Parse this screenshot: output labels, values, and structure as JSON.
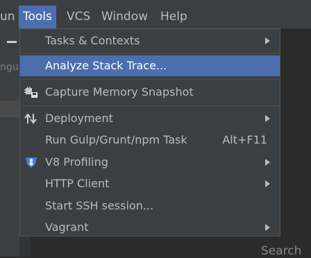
{
  "menubar": {
    "items": [
      {
        "label": "un"
      },
      {
        "label": "Tools"
      },
      {
        "label": "VCS"
      },
      {
        "label": "Window"
      },
      {
        "label": "Help"
      }
    ]
  },
  "background": {
    "left_fragment": "ngul",
    "bottom_fragment": "Search"
  },
  "colors": {
    "menu_bg": "#3c3f41",
    "highlight": "#4b6eaf",
    "text": "#bbbbbb",
    "editor_bg": "#2b2b2b"
  },
  "tools_menu": {
    "items": [
      {
        "label": "Tasks & Contexts",
        "submenu": true,
        "icon": null
      },
      {
        "label": "Analyze Stack Trace...",
        "submenu": false,
        "highlighted": true,
        "icon": null
      },
      {
        "label": "Capture Memory Snapshot",
        "submenu": false,
        "icon": "memory-snapshot-icon"
      },
      {
        "label": "Deployment",
        "submenu": true,
        "icon": "deployment-arrows-icon"
      },
      {
        "label": "Run Gulp/Grunt/npm Task",
        "shortcut": "Alt+F11",
        "submenu": false,
        "icon": null
      },
      {
        "label": "V8 Profiling",
        "submenu": true,
        "icon": "v8-profiling-icon"
      },
      {
        "label": "HTTP Client",
        "submenu": true,
        "icon": null
      },
      {
        "label": "Start SSH session...",
        "submenu": false,
        "icon": null
      },
      {
        "label": "Vagrant",
        "submenu": true,
        "icon": null
      }
    ]
  }
}
